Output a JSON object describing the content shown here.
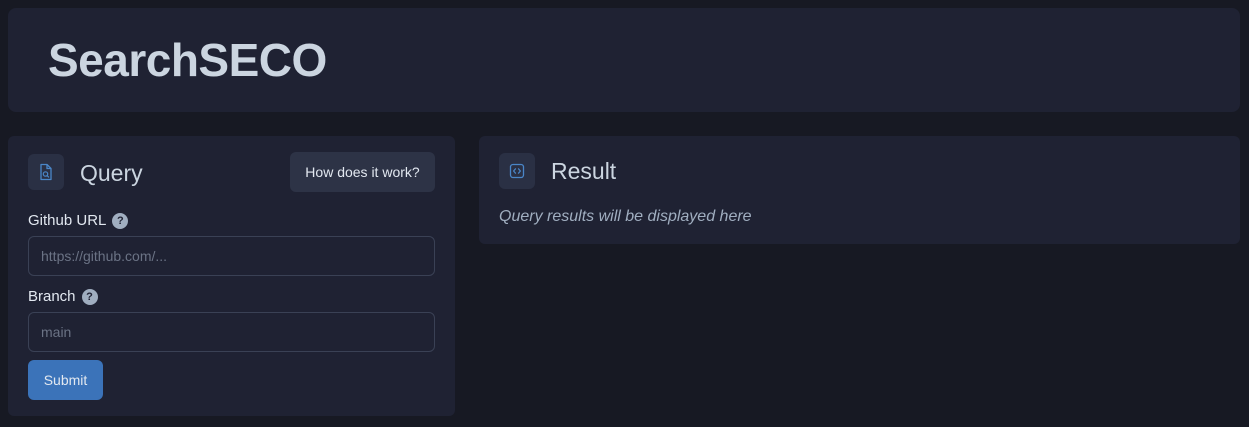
{
  "header": {
    "title": "SearchSECO"
  },
  "query": {
    "icon": "file-search-icon",
    "title": "Query",
    "how_button": "How does it work?",
    "github_url": {
      "label": "Github URL",
      "placeholder": "https://github.com/...",
      "value": ""
    },
    "branch": {
      "label": "Branch",
      "placeholder": "main",
      "value": ""
    },
    "help_glyph": "?",
    "submit": "Submit"
  },
  "result": {
    "icon": "code-icon",
    "title": "Result",
    "placeholder_text": "Query results will be displayed here"
  },
  "colors": {
    "background": "#171923",
    "panel": "#1f2233",
    "accent": "#3b73b9",
    "icon_accent": "#4a86c8"
  }
}
